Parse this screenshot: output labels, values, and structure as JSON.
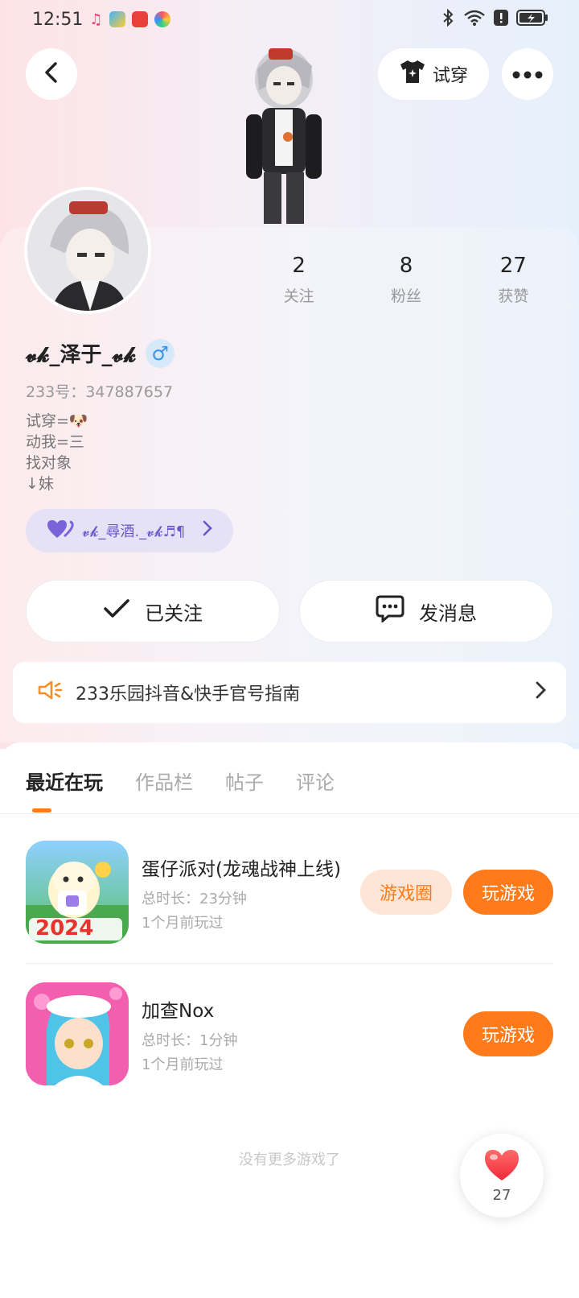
{
  "status_bar": {
    "time": "12:51"
  },
  "header": {
    "tryon_label": "试穿"
  },
  "profile": {
    "stats": [
      {
        "count": "2",
        "label": "关注"
      },
      {
        "count": "8",
        "label": "粉丝"
      },
      {
        "count": "27",
        "label": "获赞"
      }
    ],
    "nickname": "𝓿𝓴_泽于_𝓿𝓴",
    "gender_symbol": "♂",
    "uid": "233号：347887657",
    "bio_lines": [
      "试穿=🐶",
      "动我=三",
      "找对象",
      "↓妹"
    ],
    "cp_name": "𝓿𝓴_尋酒._𝓿𝓴♬¶"
  },
  "actions": {
    "follow_label": "已关注",
    "message_label": "发消息"
  },
  "notice": {
    "text": "233乐园抖音&快手官号指南"
  },
  "tabs": [
    "最近在玩",
    "作品栏",
    "帖子",
    "评论"
  ],
  "games": [
    {
      "title": "蛋仔派对(龙魂战神上线)",
      "duration": "总时长：23分钟",
      "last_played": "1个月前玩过",
      "icon_text": "2024",
      "circle_label": "游戏圈",
      "play_label": "玩游戏"
    },
    {
      "title": "加查Nox",
      "duration": "总时长：1分钟",
      "last_played": "1个月前玩过",
      "play_label": "玩游戏"
    }
  ],
  "footer": {
    "no_more": "没有更多游戏了"
  },
  "like_fab": {
    "count": "27"
  },
  "colors": {
    "accent": "#ff7a1a",
    "accent_light": "#fde6d6",
    "gender_blue": "#3a93e8",
    "cp_purple": "#6a57c8"
  }
}
